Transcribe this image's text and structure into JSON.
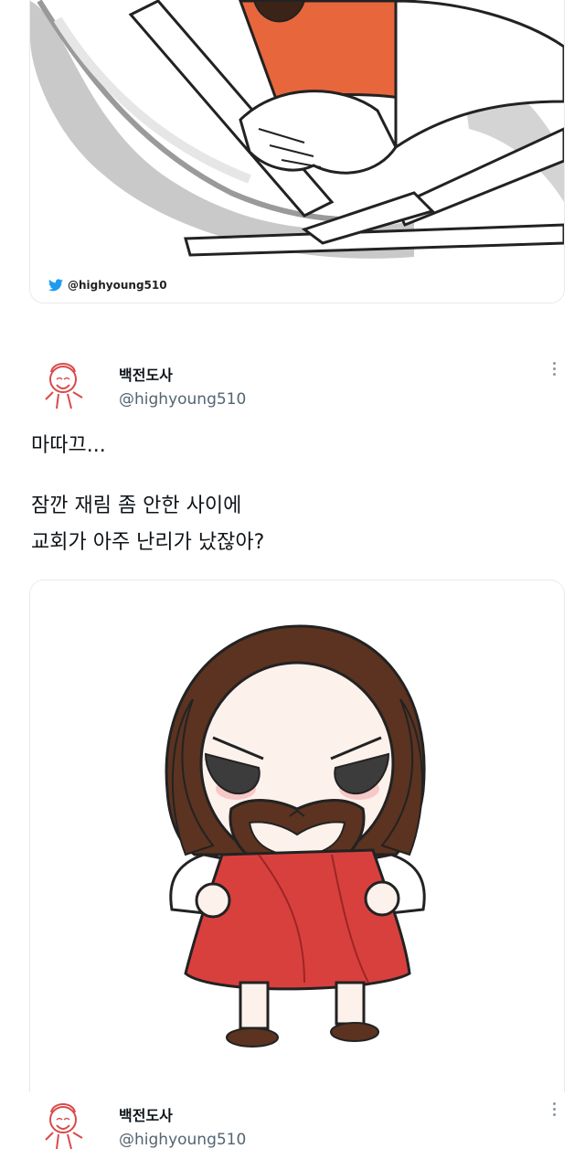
{
  "top_card": {
    "watermark_handle": "@highyoung510",
    "watermark_icon": "twitter-bird-icon"
  },
  "tweet1": {
    "display_name": "백전도사",
    "handle": "@highyoung510",
    "line1": "마따끄...",
    "line2": "잠깐 재림 좀 안한 사이에",
    "line3": "교회가 아주 난리가 났잖아?",
    "menu_icon": "more-vertical-icon"
  },
  "tweet2": {
    "display_name": "백전도사",
    "handle": "@highyoung510",
    "menu_icon": "more-vertical-icon"
  },
  "colors": {
    "accent_twitter": "#1d9bf0",
    "robe_red": "#d8403e",
    "hair_brown": "#5b3320",
    "top_robe_orange": "#e8663c"
  }
}
